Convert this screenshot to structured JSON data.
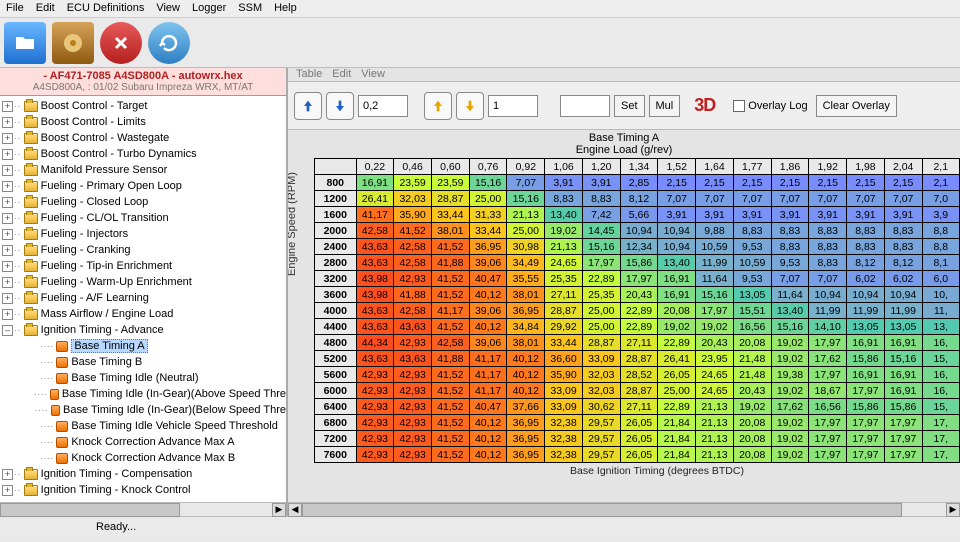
{
  "window": {
    "menus": [
      "File",
      "Edit",
      "ECU Definitions",
      "View",
      "Logger",
      "SSM",
      "Help"
    ]
  },
  "header": {
    "title": "- AF471-7085 A4SD800A - autowrx.hex",
    "subtitle": "A4SD800A, : 01/02 Subaru Impreza WRX, MT/AT"
  },
  "tree": {
    "folders": [
      "Boost Control - Target",
      "Boost Control - Limits",
      "Boost Control - Wastegate",
      "Boost Control - Turbo Dynamics",
      "Manifold Pressure Sensor",
      "Fueling - Primary Open Loop",
      "Fueling - Closed Loop",
      "Fueling - CL/OL Transition",
      "Fueling - Injectors",
      "Fueling - Cranking",
      "Fueling - Tip-in Enrichment",
      "Fueling - Warm-Up Enrichment",
      "Fueling - A/F Learning",
      "Mass Airflow / Engine Load"
    ],
    "expanded": {
      "label": "Ignition Timing - Advance",
      "items": [
        "Base Timing A",
        "Base Timing B",
        "Base Timing Idle (Neutral)",
        "Base Timing Idle (In-Gear)(Above Speed Thre",
        "Base Timing Idle (In-Gear)(Below Speed Thre",
        "Base Timing Idle Vehicle Speed Threshold",
        "Knock Correction Advance Max A",
        "Knock Correction Advance Max B"
      ],
      "selected_index": 0
    },
    "after": [
      "Ignition Timing - Compensation",
      "Ignition Timing - Knock Control"
    ]
  },
  "table_editor": {
    "small_tabs": [
      "Table",
      "Edit",
      "View"
    ],
    "step_fine": "0,2",
    "step_coarse": "1",
    "quickval": "",
    "btn_set": "Set",
    "btn_mul": "Mul",
    "btn_3d": "3D",
    "cb_overlay": "Overlay Log",
    "btn_clear_overlay": "Clear Overlay",
    "title": "Base Timing A",
    "subtitle": "Engine Load (g/rev)",
    "yaxis": "Engine Speed (RPM)",
    "xaxis": "Base Ignition Timing (degrees BTDC)"
  },
  "chart_data": {
    "type": "table",
    "title": "Base Timing A",
    "xlabel": "Engine Load (g/rev)",
    "ylabel": "Engine Speed (RPM)",
    "col_headers": [
      "0,22",
      "0,46",
      "0,60",
      "0,76",
      "0,92",
      "1,06",
      "1,20",
      "1,34",
      "1,52",
      "1,64",
      "1,77",
      "1,86",
      "1,92",
      "1,98",
      "2,04",
      "2,1"
    ],
    "row_headers": [
      "800",
      "1200",
      "1600",
      "2000",
      "2400",
      "2800",
      "3200",
      "3600",
      "4000",
      "4400",
      "4800",
      "5200",
      "5600",
      "6000",
      "6400",
      "6800",
      "7200",
      "7600"
    ],
    "values": [
      [
        "16,91",
        "23,59",
        "23,59",
        "15,16",
        "7,07",
        "3,91",
        "3,91",
        "2,85",
        "2,15",
        "2,15",
        "2,15",
        "2,15",
        "2,15",
        "2,15",
        "2,15",
        "2,1"
      ],
      [
        "26,41",
        "32,03",
        "28,87",
        "25,00",
        "15,16",
        "8,83",
        "8,83",
        "8,12",
        "7,07",
        "7,07",
        "7,07",
        "7,07",
        "7,07",
        "7,07",
        "7,07",
        "7,0"
      ],
      [
        "41,17",
        "35,90",
        "33,44",
        "31,33",
        "21,13",
        "13,40",
        "7,42",
        "5,66",
        "3,91",
        "3,91",
        "3,91",
        "3,91",
        "3,91",
        "3,91",
        "3,91",
        "3,9"
      ],
      [
        "42,58",
        "41,52",
        "38,01",
        "33,44",
        "25,00",
        "19,02",
        "14,45",
        "10,94",
        "10,94",
        "9,88",
        "8,83",
        "8,83",
        "8,83",
        "8,83",
        "8,83",
        "8,8"
      ],
      [
        "43,63",
        "42,58",
        "41,52",
        "36,95",
        "30,98",
        "21,13",
        "15,16",
        "12,34",
        "10,94",
        "10,59",
        "9,53",
        "8,83",
        "8,83",
        "8,83",
        "8,83",
        "8,8"
      ],
      [
        "43,63",
        "42,58",
        "41,88",
        "39,06",
        "34,49",
        "24,65",
        "17,97",
        "15,86",
        "13,40",
        "11,99",
        "10,59",
        "9,53",
        "8,83",
        "8,12",
        "8,12",
        "8,1"
      ],
      [
        "43,98",
        "42,93",
        "41,52",
        "40,47",
        "35,55",
        "25,35",
        "22,89",
        "17,97",
        "16,91",
        "11,64",
        "9,53",
        "7,07",
        "7,07",
        "6,02",
        "6,02",
        "6,0"
      ],
      [
        "43,98",
        "41,88",
        "41,52",
        "40,12",
        "38,01",
        "27,11",
        "25,35",
        "20,43",
        "16,91",
        "15,16",
        "13,05",
        "11,64",
        "10,94",
        "10,94",
        "10,94",
        "10,"
      ],
      [
        "43,63",
        "42,58",
        "41,17",
        "39,06",
        "36,95",
        "28,87",
        "25,00",
        "22,89",
        "20,08",
        "17,97",
        "15,51",
        "13,40",
        "11,99",
        "11,99",
        "11,99",
        "11,"
      ],
      [
        "43,63",
        "43,63",
        "41,52",
        "40,12",
        "34,84",
        "29,92",
        "25,00",
        "22,89",
        "19,02",
        "19,02",
        "16,56",
        "15,16",
        "14,10",
        "13,05",
        "13,05",
        "13,"
      ],
      [
        "44,34",
        "42,93",
        "42,58",
        "39,06",
        "38,01",
        "33,44",
        "28,87",
        "27,11",
        "22,89",
        "20,43",
        "20,08",
        "19,02",
        "17,97",
        "16,91",
        "16,91",
        "16,"
      ],
      [
        "43,63",
        "43,63",
        "41,88",
        "41,17",
        "40,12",
        "36,60",
        "33,09",
        "28,87",
        "26,41",
        "23,95",
        "21,48",
        "19,02",
        "17,62",
        "15,86",
        "15,16",
        "15,"
      ],
      [
        "42,93",
        "42,93",
        "41,52",
        "41,17",
        "40,12",
        "35,90",
        "32,03",
        "28,52",
        "26,05",
        "24,65",
        "21,48",
        "19,38",
        "17,97",
        "16,91",
        "16,91",
        "16,"
      ],
      [
        "42,93",
        "42,93",
        "41,52",
        "41,17",
        "40,12",
        "33,09",
        "32,03",
        "28,87",
        "25,00",
        "24,65",
        "20,43",
        "19,02",
        "18,67",
        "17,97",
        "16,91",
        "16,"
      ],
      [
        "42,93",
        "42,93",
        "41,52",
        "40,47",
        "37,66",
        "33,09",
        "30,62",
        "27,11",
        "22,89",
        "21,13",
        "19,02",
        "17,62",
        "16,56",
        "15,86",
        "15,86",
        "15,"
      ],
      [
        "42,93",
        "42,93",
        "41,52",
        "40,12",
        "36,95",
        "32,38",
        "29,57",
        "26,05",
        "21,84",
        "21,13",
        "20,08",
        "19,02",
        "17,97",
        "17,97",
        "17,97",
        "17,"
      ],
      [
        "42,93",
        "42,93",
        "41,52",
        "40,12",
        "36,95",
        "32,38",
        "29,57",
        "26,05",
        "21,84",
        "21,13",
        "20,08",
        "19,02",
        "17,97",
        "17,97",
        "17,97",
        "17,"
      ],
      [
        "42,93",
        "42,93",
        "41,52",
        "40,12",
        "36,95",
        "32,38",
        "29,57",
        "26,05",
        "21,84",
        "21,13",
        "20,08",
        "19,02",
        "17,97",
        "17,97",
        "17,97",
        "17,"
      ]
    ]
  },
  "status": {
    "text": "Ready..."
  }
}
